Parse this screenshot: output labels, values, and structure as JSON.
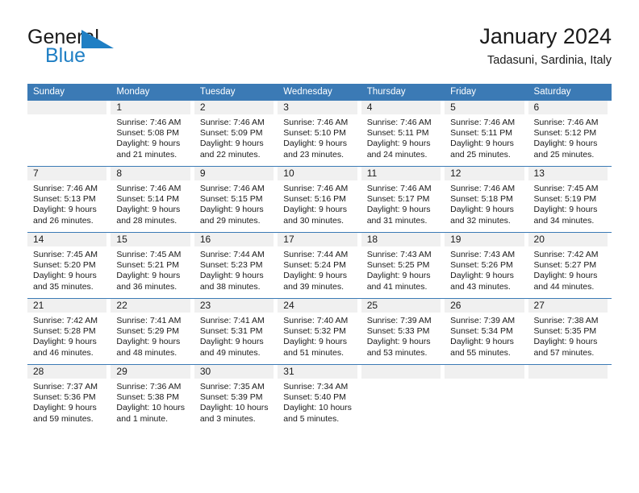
{
  "brand": {
    "name_part1": "General",
    "name_part2": "Blue",
    "triangle_color": "#1f7fc4",
    "blue_color": "#1f7fc4"
  },
  "header": {
    "title": "January 2024",
    "subtitle": "Tadasuni, Sardinia, Italy"
  },
  "theme": {
    "header_blue": "#3b7ab5",
    "day_band_gray": "#f0f0f0",
    "text_color": "#1a1a1a"
  },
  "weekdays": [
    "Sunday",
    "Monday",
    "Tuesday",
    "Wednesday",
    "Thursday",
    "Friday",
    "Saturday"
  ],
  "weeks": [
    {
      "days": [
        {
          "num": "",
          "lines": []
        },
        {
          "num": "1",
          "lines": [
            "Sunrise: 7:46 AM",
            "Sunset: 5:08 PM",
            "Daylight: 9 hours",
            "and 21 minutes."
          ]
        },
        {
          "num": "2",
          "lines": [
            "Sunrise: 7:46 AM",
            "Sunset: 5:09 PM",
            "Daylight: 9 hours",
            "and 22 minutes."
          ]
        },
        {
          "num": "3",
          "lines": [
            "Sunrise: 7:46 AM",
            "Sunset: 5:10 PM",
            "Daylight: 9 hours",
            "and 23 minutes."
          ]
        },
        {
          "num": "4",
          "lines": [
            "Sunrise: 7:46 AM",
            "Sunset: 5:11 PM",
            "Daylight: 9 hours",
            "and 24 minutes."
          ]
        },
        {
          "num": "5",
          "lines": [
            "Sunrise: 7:46 AM",
            "Sunset: 5:11 PM",
            "Daylight: 9 hours",
            "and 25 minutes."
          ]
        },
        {
          "num": "6",
          "lines": [
            "Sunrise: 7:46 AM",
            "Sunset: 5:12 PM",
            "Daylight: 9 hours",
            "and 25 minutes."
          ]
        }
      ]
    },
    {
      "days": [
        {
          "num": "7",
          "lines": [
            "Sunrise: 7:46 AM",
            "Sunset: 5:13 PM",
            "Daylight: 9 hours",
            "and 26 minutes."
          ]
        },
        {
          "num": "8",
          "lines": [
            "Sunrise: 7:46 AM",
            "Sunset: 5:14 PM",
            "Daylight: 9 hours",
            "and 28 minutes."
          ]
        },
        {
          "num": "9",
          "lines": [
            "Sunrise: 7:46 AM",
            "Sunset: 5:15 PM",
            "Daylight: 9 hours",
            "and 29 minutes."
          ]
        },
        {
          "num": "10",
          "lines": [
            "Sunrise: 7:46 AM",
            "Sunset: 5:16 PM",
            "Daylight: 9 hours",
            "and 30 minutes."
          ]
        },
        {
          "num": "11",
          "lines": [
            "Sunrise: 7:46 AM",
            "Sunset: 5:17 PM",
            "Daylight: 9 hours",
            "and 31 minutes."
          ]
        },
        {
          "num": "12",
          "lines": [
            "Sunrise: 7:46 AM",
            "Sunset: 5:18 PM",
            "Daylight: 9 hours",
            "and 32 minutes."
          ]
        },
        {
          "num": "13",
          "lines": [
            "Sunrise: 7:45 AM",
            "Sunset: 5:19 PM",
            "Daylight: 9 hours",
            "and 34 minutes."
          ]
        }
      ]
    },
    {
      "days": [
        {
          "num": "14",
          "lines": [
            "Sunrise: 7:45 AM",
            "Sunset: 5:20 PM",
            "Daylight: 9 hours",
            "and 35 minutes."
          ]
        },
        {
          "num": "15",
          "lines": [
            "Sunrise: 7:45 AM",
            "Sunset: 5:21 PM",
            "Daylight: 9 hours",
            "and 36 minutes."
          ]
        },
        {
          "num": "16",
          "lines": [
            "Sunrise: 7:44 AM",
            "Sunset: 5:23 PM",
            "Daylight: 9 hours",
            "and 38 minutes."
          ]
        },
        {
          "num": "17",
          "lines": [
            "Sunrise: 7:44 AM",
            "Sunset: 5:24 PM",
            "Daylight: 9 hours",
            "and 39 minutes."
          ]
        },
        {
          "num": "18",
          "lines": [
            "Sunrise: 7:43 AM",
            "Sunset: 5:25 PM",
            "Daylight: 9 hours",
            "and 41 minutes."
          ]
        },
        {
          "num": "19",
          "lines": [
            "Sunrise: 7:43 AM",
            "Sunset: 5:26 PM",
            "Daylight: 9 hours",
            "and 43 minutes."
          ]
        },
        {
          "num": "20",
          "lines": [
            "Sunrise: 7:42 AM",
            "Sunset: 5:27 PM",
            "Daylight: 9 hours",
            "and 44 minutes."
          ]
        }
      ]
    },
    {
      "days": [
        {
          "num": "21",
          "lines": [
            "Sunrise: 7:42 AM",
            "Sunset: 5:28 PM",
            "Daylight: 9 hours",
            "and 46 minutes."
          ]
        },
        {
          "num": "22",
          "lines": [
            "Sunrise: 7:41 AM",
            "Sunset: 5:29 PM",
            "Daylight: 9 hours",
            "and 48 minutes."
          ]
        },
        {
          "num": "23",
          "lines": [
            "Sunrise: 7:41 AM",
            "Sunset: 5:31 PM",
            "Daylight: 9 hours",
            "and 49 minutes."
          ]
        },
        {
          "num": "24",
          "lines": [
            "Sunrise: 7:40 AM",
            "Sunset: 5:32 PM",
            "Daylight: 9 hours",
            "and 51 minutes."
          ]
        },
        {
          "num": "25",
          "lines": [
            "Sunrise: 7:39 AM",
            "Sunset: 5:33 PM",
            "Daylight: 9 hours",
            "and 53 minutes."
          ]
        },
        {
          "num": "26",
          "lines": [
            "Sunrise: 7:39 AM",
            "Sunset: 5:34 PM",
            "Daylight: 9 hours",
            "and 55 minutes."
          ]
        },
        {
          "num": "27",
          "lines": [
            "Sunrise: 7:38 AM",
            "Sunset: 5:35 PM",
            "Daylight: 9 hours",
            "and 57 minutes."
          ]
        }
      ]
    },
    {
      "days": [
        {
          "num": "28",
          "lines": [
            "Sunrise: 7:37 AM",
            "Sunset: 5:36 PM",
            "Daylight: 9 hours",
            "and 59 minutes."
          ]
        },
        {
          "num": "29",
          "lines": [
            "Sunrise: 7:36 AM",
            "Sunset: 5:38 PM",
            "Daylight: 10 hours",
            "and 1 minute."
          ]
        },
        {
          "num": "30",
          "lines": [
            "Sunrise: 7:35 AM",
            "Sunset: 5:39 PM",
            "Daylight: 10 hours",
            "and 3 minutes."
          ]
        },
        {
          "num": "31",
          "lines": [
            "Sunrise: 7:34 AM",
            "Sunset: 5:40 PM",
            "Daylight: 10 hours",
            "and 5 minutes."
          ]
        },
        {
          "num": "",
          "lines": []
        },
        {
          "num": "",
          "lines": []
        },
        {
          "num": "",
          "lines": []
        }
      ]
    }
  ]
}
